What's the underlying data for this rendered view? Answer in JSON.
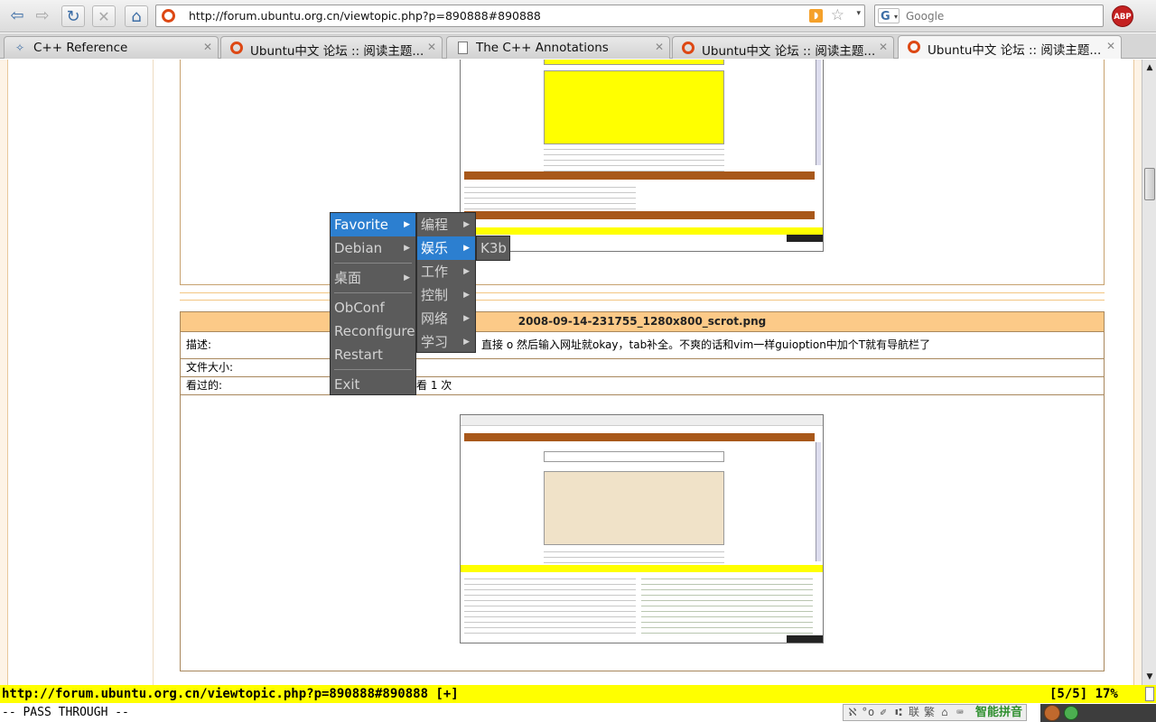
{
  "browser": {
    "url": "http://forum.ubuntu.org.cn/viewtopic.php?p=890888#890888",
    "search_placeholder": "Google",
    "abp_label": "ABP",
    "tabs": [
      {
        "label": "C++ Reference",
        "icon": "ext-icon",
        "active": false
      },
      {
        "label": "Ubuntu中文 论坛 :: 阅读主题...",
        "icon": "ubuntu-icon",
        "active": false
      },
      {
        "label": "The C++ Annotations",
        "icon": "document-icon",
        "active": false
      },
      {
        "label": "Ubuntu中文 论坛 :: 阅读主题...",
        "icon": "ubuntu-icon",
        "active": false
      },
      {
        "label": "Ubuntu中文 论坛 :: 阅读主题...",
        "icon": "ubuntu-icon",
        "active": true
      }
    ]
  },
  "attachment": {
    "filename": "2008-09-14-231755_1280x800_scrot.png",
    "desc_label": "描述:",
    "desc_value": "没有导航栏，直接 o 然后输入网址就okay，tab补全。不爽的话和vim一样guioption中加个T就有导航栏了",
    "size_label": "文件大小:",
    "views_label": "看过的:",
    "views_value": "看 1 次"
  },
  "openbox_menu": {
    "root": [
      {
        "label": "Favorite",
        "has_sub": true,
        "selected": true
      },
      {
        "label": "Debian",
        "has_sub": true
      },
      {
        "label": "桌面",
        "has_sub": true
      },
      {
        "label": "ObConf"
      },
      {
        "label": "Reconfigure"
      },
      {
        "label": "Restart"
      },
      {
        "label": "Exit"
      }
    ],
    "favorite": [
      {
        "label": "编程",
        "has_sub": true
      },
      {
        "label": "娱乐",
        "has_sub": true,
        "selected": true
      },
      {
        "label": "工作",
        "has_sub": true
      },
      {
        "label": "控制",
        "has_sub": true
      },
      {
        "label": "网络",
        "has_sub": true
      },
      {
        "label": "学习",
        "has_sub": true
      }
    ],
    "entertainment": [
      {
        "label": "K3b"
      }
    ]
  },
  "vimperator": {
    "status_url": "http://forum.ubuntu.org.cn/viewtopic.php?p=890888#890888 [+]",
    "status_position": "[5/5] 17%",
    "mode": "-- PASS THROUGH --"
  },
  "ime": {
    "name": "智能拼音",
    "glyphs": [
      "ℵ",
      "°o",
      "✐",
      "⑆",
      "联",
      "繁",
      "⌂",
      "⌨"
    ]
  },
  "colors": {
    "menu_bg": "#5b5b5b",
    "menu_selected": "#2c7fd0",
    "status_bar": "#ffff00",
    "table_header": "#fcca88"
  }
}
